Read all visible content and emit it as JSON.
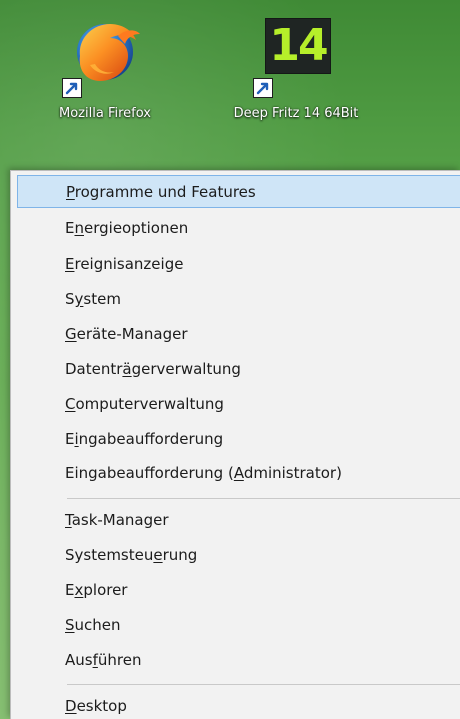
{
  "desktop": {
    "icons": [
      {
        "label": "Mozilla Firefox",
        "icon": "firefox-icon",
        "shortcut_icon": "shortcut-arrow-icon"
      },
      {
        "label": "Deep Fritz 14 64Bit",
        "icon": "deep-fritz-14-icon",
        "tile_text": "14",
        "shortcut_icon": "shortcut-arrow-icon"
      }
    ]
  },
  "context_menu": {
    "items": [
      {
        "label": "Programme und Features",
        "mnemonic_index": 0,
        "selected": true
      },
      {
        "label": "Energieoptionen",
        "mnemonic_index": 1,
        "selected": false
      },
      {
        "label": "Ereignisanzeige",
        "mnemonic_index": 0,
        "selected": false
      },
      {
        "label": "System",
        "mnemonic_index": 1,
        "selected": false
      },
      {
        "label": "Geräte-Manager",
        "mnemonic_index": 0,
        "selected": false
      },
      {
        "label": "Datenträgerverwaltung",
        "mnemonic_index": 7,
        "selected": false
      },
      {
        "label": "Computerverwaltung",
        "mnemonic_index": 0,
        "selected": false
      },
      {
        "label": "Eingabeaufforderung",
        "mnemonic_index": 1,
        "selected": false
      },
      {
        "label": "Eingabeaufforderung (Administrator)",
        "mnemonic_index": 21,
        "selected": false
      },
      {
        "label": "Task-Manager",
        "mnemonic_index": 0,
        "selected": false
      },
      {
        "label": "Systemsteuerung",
        "mnemonic_index": 10,
        "selected": false
      },
      {
        "label": "Explorer",
        "mnemonic_index": 1,
        "selected": false
      },
      {
        "label": "Suchen",
        "mnemonic_index": 0,
        "selected": false
      },
      {
        "label": "Ausführen",
        "mnemonic_index": 3,
        "selected": false
      },
      {
        "label": "Desktop",
        "mnemonic_index": 0,
        "selected": false
      }
    ]
  },
  "colors": {
    "selected_bg": "#cfe5f7",
    "selected_border": "#7fb4e8",
    "menu_bg": "#f2f2f2"
  }
}
